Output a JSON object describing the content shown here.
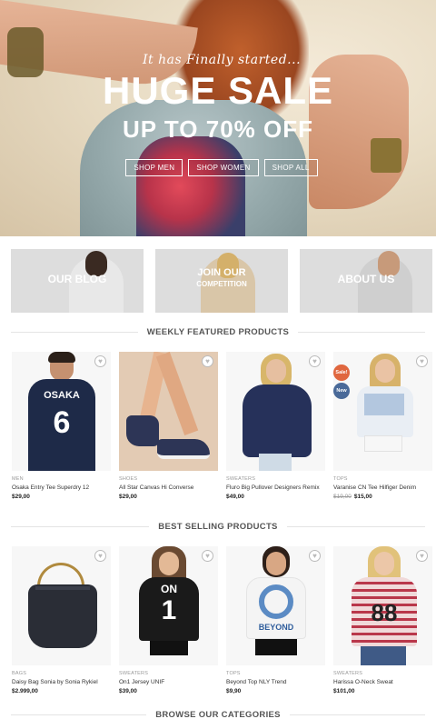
{
  "hero": {
    "tagline": "It has Finally started...",
    "title": "HUGE SALE",
    "subtitle": "UP TO 70% OFF",
    "buttons": [
      "SHOP MEN",
      "SHOP WOMEN",
      "SHOP ALL"
    ]
  },
  "banners": [
    {
      "label": "OUR BLOG"
    },
    {
      "label": "JOIN OUR",
      "sublabel": "COMPETITION"
    },
    {
      "label": "ABOUT US"
    }
  ],
  "featured": {
    "title": "WEEKLY FEATURED PRODUCTS",
    "products": [
      {
        "category": "MEN",
        "name": "Osaka Entry Tee Superdry 12",
        "price": "$29,00",
        "shirt_text": "OSAKA"
      },
      {
        "category": "SHOES",
        "name": "All Star Canvas Hi Converse",
        "price": "$29,00"
      },
      {
        "category": "SWEATERS",
        "name": "Fluro Big Pullover Designers Remix",
        "price": "$49,00"
      },
      {
        "category": "TOPS",
        "name": "Varanise CN Tee Hilfiger Denim",
        "old_price": "$19,00",
        "price": "$15,00",
        "badges": [
          "Sale!",
          "New"
        ]
      }
    ]
  },
  "bestselling": {
    "title": "BEST SELLING PRODUCTS",
    "products": [
      {
        "category": "BAGS",
        "name": "Daisy Bag Sonia by Sonia Rykiel",
        "price": "$2.999,00"
      },
      {
        "category": "SWEATERS",
        "name": "On1 Jersey UNIF",
        "price": "$39,00",
        "shirt_text": "ON"
      },
      {
        "category": "TOPS",
        "name": "Beyond Top NLY Trend",
        "price": "$9,90",
        "shirt_text": "BEYOND"
      },
      {
        "category": "SWEATERS",
        "name": "Harissa O-Neck Sweat",
        "price": "$101,00"
      }
    ]
  },
  "categories": {
    "title": "BROWSE OUR CATEGORIES"
  },
  "colors": {
    "sale_badge": "#e0673f",
    "new_badge": "#4a6a99"
  }
}
